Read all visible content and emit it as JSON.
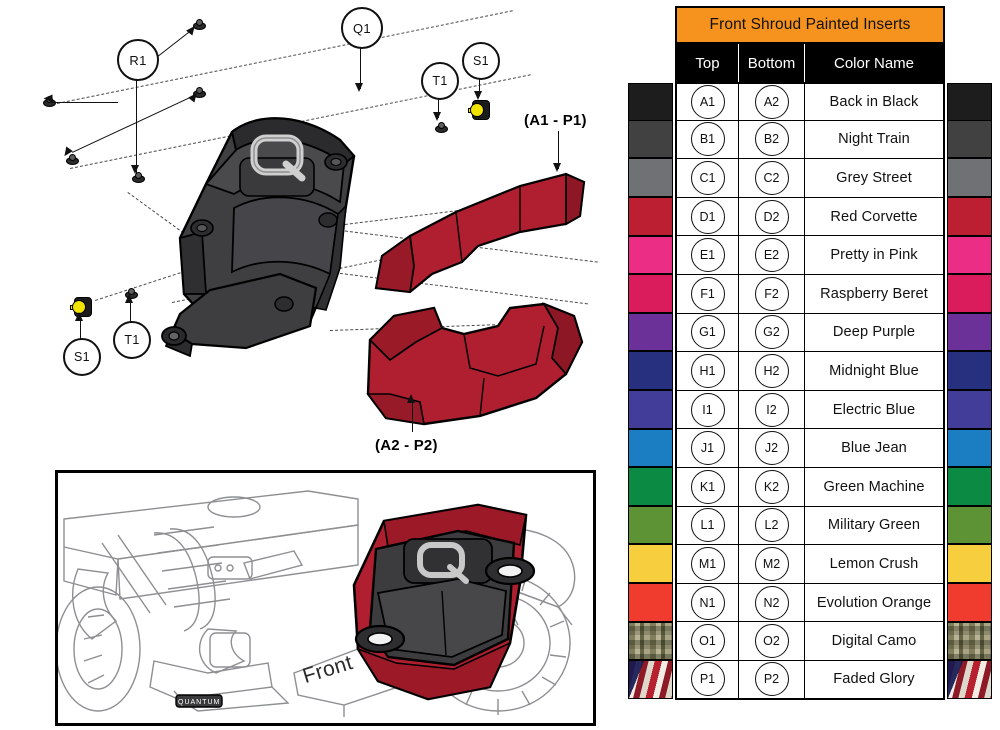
{
  "title": "Front Shroud Painted Inserts",
  "table": {
    "header": "Front Shroud Painted Inserts",
    "columns": {
      "top": "Top",
      "bottom": "Bottom",
      "name": "Color Name"
    },
    "rows": [
      {
        "top": "A1",
        "bottom": "A2",
        "name": "Back in Black",
        "color": "#1d1d1d",
        "type": "solid"
      },
      {
        "top": "B1",
        "bottom": "B2",
        "name": "Night Train",
        "color": "#414142",
        "type": "solid"
      },
      {
        "top": "C1",
        "bottom": "C2",
        "name": "Grey Street",
        "color": "#6f7175",
        "type": "solid"
      },
      {
        "top": "D1",
        "bottom": "D2",
        "name": "Red Corvette",
        "color": "#bd1f32",
        "type": "solid"
      },
      {
        "top": "E1",
        "bottom": "E2",
        "name": "Pretty in Pink",
        "color": "#ec2d85",
        "type": "solid"
      },
      {
        "top": "F1",
        "bottom": "F2",
        "name": "Raspberry Beret",
        "color": "#da1b5c",
        "type": "solid"
      },
      {
        "top": "G1",
        "bottom": "G2",
        "name": "Deep Purple",
        "color": "#6c3198",
        "type": "solid"
      },
      {
        "top": "H1",
        "bottom": "H2",
        "name": "Midnight Blue",
        "color": "#27307e",
        "type": "solid"
      },
      {
        "top": "I1",
        "bottom": "I2",
        "name": "Electric Blue",
        "color": "#413d99",
        "type": "solid"
      },
      {
        "top": "J1",
        "bottom": "J2",
        "name": "Blue Jean",
        "color": "#1b7ec2",
        "type": "solid"
      },
      {
        "top": "K1",
        "bottom": "K2",
        "name": "Green Machine",
        "color": "#0a8a42",
        "type": "solid"
      },
      {
        "top": "L1",
        "bottom": "L2",
        "name": "Military Green",
        "color": "#5e9335",
        "type": "solid"
      },
      {
        "top": "M1",
        "bottom": "M2",
        "name": "Lemon Crush",
        "color": "#f6ce3e",
        "type": "solid"
      },
      {
        "top": "N1",
        "bottom": "N2",
        "name": "Evolution Orange",
        "color": "#f03c2e",
        "type": "solid"
      },
      {
        "top": "O1",
        "bottom": "O2",
        "name": "Digital Camo",
        "color": "#9a9878",
        "type": "camo"
      },
      {
        "top": "P1",
        "bottom": "P2",
        "name": "Faded Glory",
        "color": "#8d2230",
        "type": "flag"
      }
    ]
  },
  "diagram": {
    "callouts": [
      {
        "id": "R1",
        "label": "R1"
      },
      {
        "id": "Q1",
        "label": "Q1"
      },
      {
        "id": "T1_upper",
        "label": "T1"
      },
      {
        "id": "S1_upper",
        "label": "S1"
      },
      {
        "id": "T1_lower",
        "label": "T1"
      },
      {
        "id": "S1_lower",
        "label": "S1"
      }
    ],
    "part_labels": [
      {
        "id": "top_insert",
        "text": "(A1 - P1)"
      },
      {
        "id": "bottom_insert",
        "text": "(A2 - P2)"
      }
    ],
    "shroud_color": "#3a3a3c",
    "insert_color": "#b01f2f"
  },
  "inset": {
    "orientation_label": "Front"
  }
}
